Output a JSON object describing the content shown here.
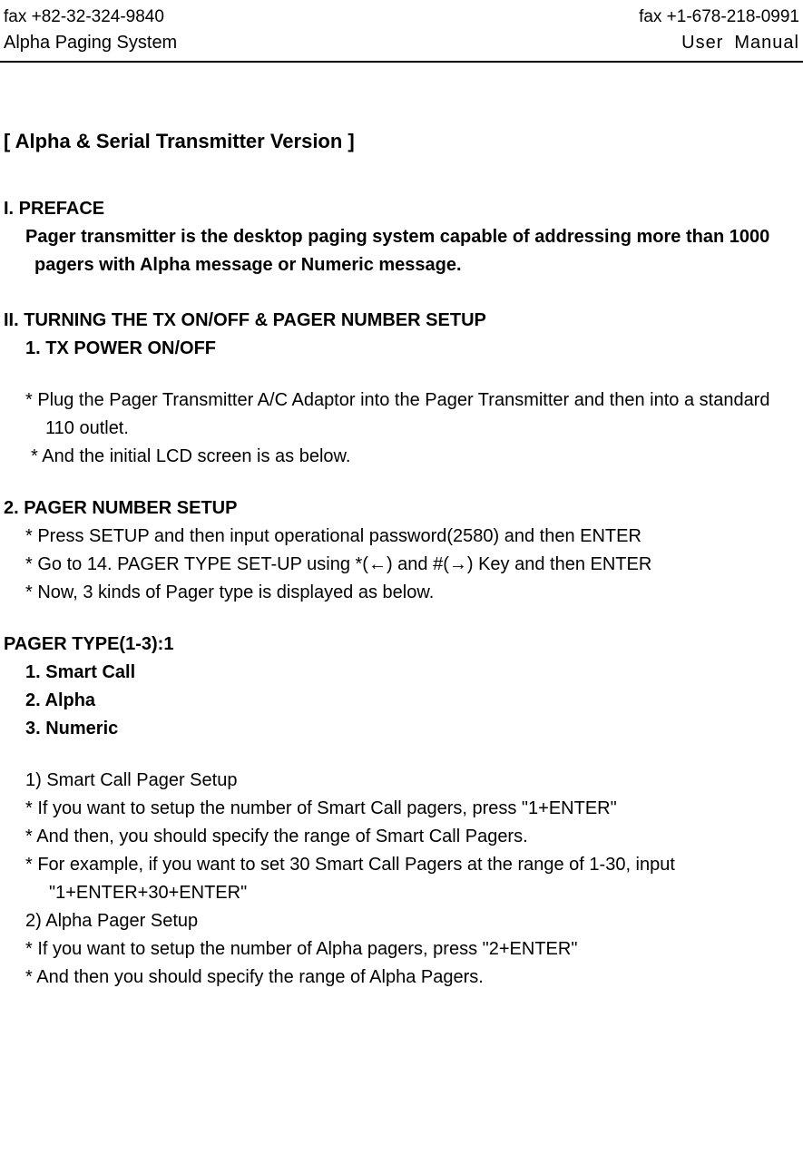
{
  "header": {
    "fax_left": "fax +82-32-324-9840",
    "fax_right": "fax +1-678-218-0991",
    "title_left": "Alpha Paging System",
    "title_right_user": "User",
    "title_right_manual": "Manual"
  },
  "main": {
    "title": "[ Alpha & Serial Transmitter Version ]",
    "preface": {
      "heading": "I. PREFACE",
      "line1": "Pager transmitter is the desktop paging system capable of addressing more than 1000",
      "line2": "pagers with Alpha message or Numeric message."
    },
    "section2": {
      "heading": "II. TURNING THE TX ON/OFF & PAGER NUMBER SETUP",
      "sub1": "1. TX POWER ON/OFF",
      "s1line1": "* Plug the Pager Transmitter A/C Adaptor into the Pager Transmitter and then into a standard",
      "s1line2": "110 outlet.",
      "s1line3": "* And the initial LCD screen is as below."
    },
    "section_pager": {
      "heading": "2. PAGER NUMBER SETUP",
      "line1": "* Press SETUP and then input operational password(2580) and then ENTER",
      "line2": "* Go to 14. PAGER TYPE SET-UP using *(←) and #(→) Key and then ENTER",
      "line3": "* Now, 3 kinds of Pager type is displayed as below."
    },
    "pager_type": {
      "heading": "PAGER TYPE(1-3):1",
      "opt1": "1. Smart Call",
      "opt2": "2. Alpha",
      "opt3": "3. Numeric"
    },
    "smartcall": {
      "line1": "1) Smart Call Pager Setup",
      "line2": "* If you want to setup the number of Smart Call pagers, press \"1+ENTER\"",
      "line3": "* And then, you should specify the range of Smart Call Pagers.",
      "line4": "* For example, if you want to set 30 Smart Call Pagers at the range of 1-30, input",
      "line5": "\"1+ENTER+30+ENTER\""
    },
    "alpha": {
      "line1": "2) Alpha Pager Setup",
      "line2": "* If you want to setup the number of Alpha pagers, press \"2+ENTER\"",
      "line3": "* And then you should specify the range of Alpha Pagers."
    }
  }
}
